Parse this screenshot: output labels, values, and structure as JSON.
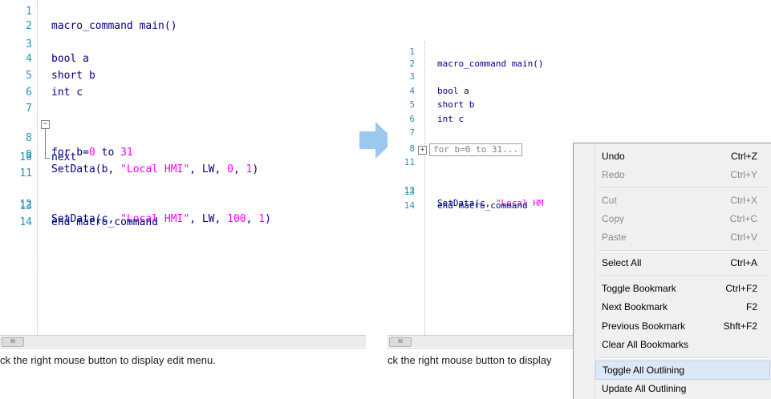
{
  "left_editor": {
    "line_numbers": [
      "1",
      "2",
      "3",
      "4",
      "5",
      "6",
      "7",
      "8",
      "9",
      "10",
      "11",
      "12",
      "13",
      "14"
    ],
    "code": {
      "l2": "macro_command main()",
      "l4": "bool a",
      "l5": "short b",
      "l6": "int c",
      "l8_kw": "for b=",
      "l8_n1": "0",
      "l8_to": " to ",
      "l8_n2": "31",
      "l9_a": "SetData(b, ",
      "l9_str": "\"Local HMI\"",
      "l9_b": ", LW, ",
      "l9_n1": "0",
      "l9_c": ", ",
      "l9_n2": "1",
      "l9_d": ")",
      "l10": "next",
      "l12_a": "SetData(c, ",
      "l12_str": "\"Local HMI\"",
      "l12_b": ", LW, ",
      "l12_n1": "100",
      "l12_c": ", ",
      "l12_n2": "1",
      "l12_d": ")",
      "l14": "end macro_command"
    },
    "status_text": "ck the right mouse button to display edit menu."
  },
  "right_editor": {
    "line_numbers": [
      "1",
      "2",
      "3",
      "4",
      "5",
      "6",
      "7",
      "8",
      "11",
      "12",
      "13",
      "14"
    ],
    "code": {
      "l2": "macro_command main()",
      "l4": "bool a",
      "l5": "short b",
      "l6": "int c",
      "l8_collapsed": "for b=0 to 31...",
      "l12_a": "SetData(c, ",
      "l12_str": "\"Local HM",
      "l14": "end macro_command"
    },
    "status_text": "ck the right mouse button to display"
  },
  "scroll_thumb_glyph": "III",
  "arrow_color": "#9cc7ef",
  "context_menu": {
    "items": [
      {
        "label": "Undo",
        "shortcut": "Ctrl+Z",
        "enabled": true
      },
      {
        "label": "Redo",
        "shortcut": "Ctrl+Y",
        "enabled": false
      },
      {
        "label": "Cut",
        "shortcut": "Ctrl+X",
        "enabled": false
      },
      {
        "label": "Copy",
        "shortcut": "Ctrl+C",
        "enabled": false
      },
      {
        "label": "Paste",
        "shortcut": "Ctrl+V",
        "enabled": false
      },
      {
        "label": "Select All",
        "shortcut": "Ctrl+A",
        "enabled": true
      },
      {
        "label": "Toggle Bookmark",
        "shortcut": "Ctrl+F2",
        "enabled": true
      },
      {
        "label": "Next Bookmark",
        "shortcut": "F2",
        "enabled": true
      },
      {
        "label": "Previous Bookmark",
        "shortcut": "Shft+F2",
        "enabled": true
      },
      {
        "label": "Clear All Bookmarks",
        "shortcut": "",
        "enabled": true
      },
      {
        "label": "Toggle All Outlining",
        "shortcut": "",
        "enabled": true,
        "highlighted": true
      },
      {
        "label": "Update All Outlining",
        "shortcut": "",
        "enabled": true
      }
    ]
  }
}
